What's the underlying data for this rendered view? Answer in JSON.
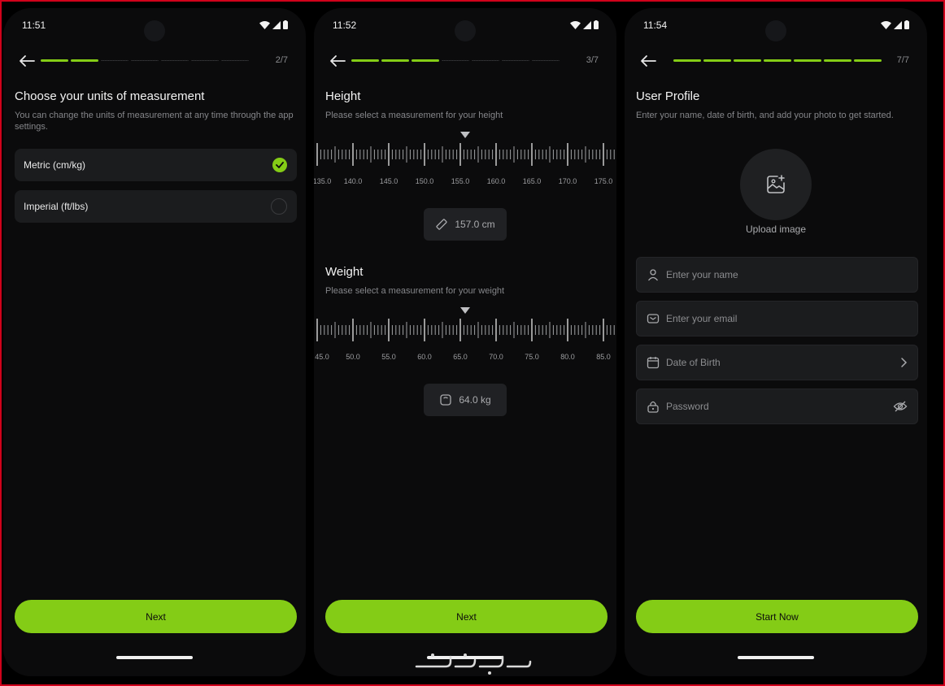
{
  "screens": [
    {
      "time": "11:51",
      "step": "2/7",
      "progress_total": 7,
      "progress_done": 2,
      "title": "Choose your units of measurement",
      "subtitle": "You can change the units of measurement at any time through the app settings.",
      "options": [
        {
          "label": "Metric (cm/kg)",
          "selected": true
        },
        {
          "label": "Imperial (ft/lbs)",
          "selected": false
        }
      ],
      "button": "Next"
    },
    {
      "time": "11:52",
      "step": "3/7",
      "progress_total": 7,
      "progress_done": 3,
      "height": {
        "title": "Height",
        "subtitle": "Please select a measurement for your height",
        "tick_labels": [
          "135.0",
          "140.0",
          "145.0",
          "150.0",
          "155.0",
          "160.0",
          "165.0",
          "170.0",
          "175.0"
        ],
        "value": "157.0 cm"
      },
      "weight": {
        "title": "Weight",
        "subtitle": "Please select a measurement for your weight",
        "tick_labels": [
          "45.0",
          "50.0",
          "55.0",
          "60.0",
          "65.0",
          "70.0",
          "75.0",
          "80.0",
          "85.0"
        ],
        "value": "64.0 kg"
      },
      "button": "Next"
    },
    {
      "time": "11:54",
      "step": "7/7",
      "progress_total": 7,
      "progress_done": 7,
      "title": "User Profile",
      "subtitle": "Enter your name, date of birth, and add your photo to get started.",
      "upload_label": "Upload image",
      "fields": {
        "name_placeholder": "Enter your name",
        "email_placeholder": "Enter your email",
        "dob_label": "Date of Birth",
        "password_placeholder": "Password"
      },
      "button": "Start Now"
    }
  ],
  "colors": {
    "accent": "#84cc16",
    "background": "#0b0b0c",
    "card": "#1b1c1e"
  }
}
